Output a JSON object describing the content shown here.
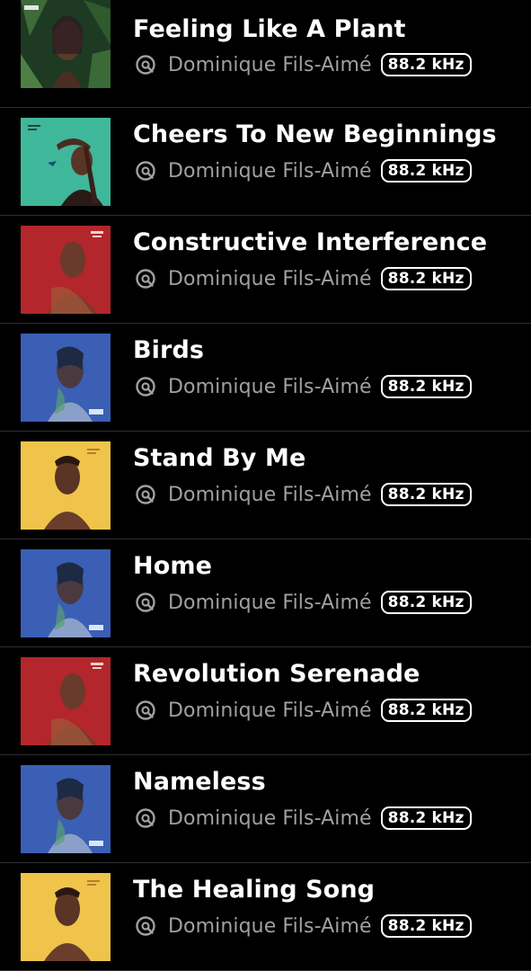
{
  "tracks": [
    {
      "title": "Feeling Like A Plant",
      "artist": "Dominique Fils-Aimé",
      "quality": "88.2 kHz",
      "cover": "green-leaves"
    },
    {
      "title": "Cheers To New Beginnings",
      "artist": "Dominique Fils-Aimé",
      "quality": "88.2 kHz",
      "cover": "teal"
    },
    {
      "title": "Constructive Interference",
      "artist": "Dominique Fils-Aimé",
      "quality": "88.2 kHz",
      "cover": "red"
    },
    {
      "title": "Birds",
      "artist": "Dominique Fils-Aimé",
      "quality": "88.2 kHz",
      "cover": "blue"
    },
    {
      "title": "Stand By Me",
      "artist": "Dominique Fils-Aimé",
      "quality": "88.2 kHz",
      "cover": "yellow"
    },
    {
      "title": "Home",
      "artist": "Dominique Fils-Aimé",
      "quality": "88.2 kHz",
      "cover": "blue"
    },
    {
      "title": "Revolution Serenade",
      "artist": "Dominique Fils-Aimé",
      "quality": "88.2 kHz",
      "cover": "red"
    },
    {
      "title": "Nameless",
      "artist": "Dominique Fils-Aimé",
      "quality": "88.2 kHz",
      "cover": "blue"
    },
    {
      "title": "The Healing Song",
      "artist": "Dominique Fils-Aimé",
      "quality": "88.2 kHz",
      "cover": "yellow"
    }
  ],
  "icons": {
    "lossless": "lossless-icon"
  },
  "colors": {
    "background": "#000000",
    "title": "#ffffff",
    "artist": "#a0a0a0",
    "divider": "#2e2e2e"
  }
}
